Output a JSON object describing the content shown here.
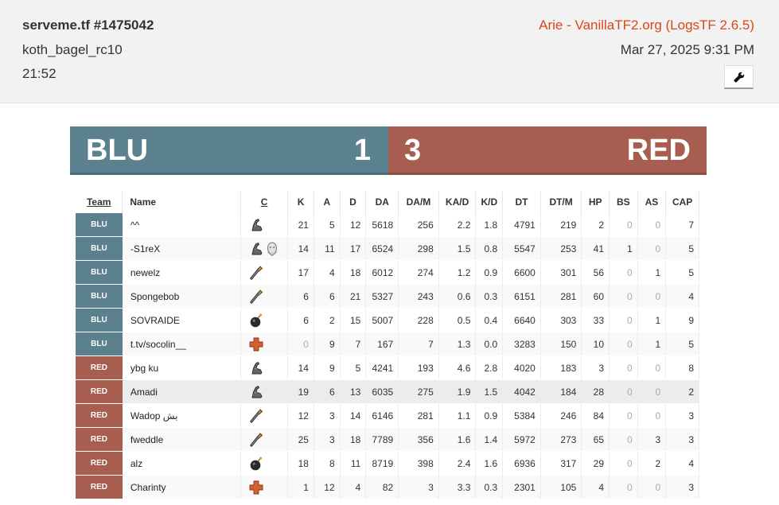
{
  "header": {
    "title": "serveme.tf #1475042",
    "map": "koth_bagel_rc10",
    "duration": "21:52",
    "uploader_link": "Arie - VanillaTF2.org (LogsTF 2.6.5)",
    "date": "Mar 27, 2025 9:31 PM",
    "tools_icon": "wrench-icon"
  },
  "score": {
    "blu_name": "BLU",
    "blu_score": "1",
    "red_score": "3",
    "red_name": "RED",
    "blu_color": "#5b818f",
    "red_color": "#a75d50"
  },
  "table": {
    "columns": [
      "Team",
      "Name",
      "C",
      "K",
      "A",
      "D",
      "DA",
      "DA/M",
      "KA/D",
      "K/D",
      "DT",
      "DT/M",
      "HP",
      "BS",
      "AS",
      "CAP"
    ],
    "rows": [
      {
        "team": "BLU",
        "name": "^^",
        "classes": [
          "scout"
        ],
        "k": "21",
        "a": "5",
        "d": "12",
        "da": "5618",
        "dam": "256",
        "kad": "2.2",
        "kd": "1.8",
        "dt": "4791",
        "dtm": "219",
        "hp": "2",
        "bs": "0",
        "as": "0",
        "cap": "7"
      },
      {
        "team": "BLU",
        "name": "-S1reX",
        "classes": [
          "scout",
          "spy"
        ],
        "k": "14",
        "a": "11",
        "d": "17",
        "da": "6524",
        "dam": "298",
        "kad": "1.5",
        "kd": "0.8",
        "dt": "5547",
        "dtm": "253",
        "hp": "41",
        "bs": "1",
        "as": "0",
        "cap": "5"
      },
      {
        "team": "BLU",
        "name": "newelz",
        "classes": [
          "soldier"
        ],
        "k": "17",
        "a": "4",
        "d": "18",
        "da": "6012",
        "dam": "274",
        "kad": "1.2",
        "kd": "0.9",
        "dt": "6600",
        "dtm": "301",
        "hp": "56",
        "bs": "0",
        "as": "1",
        "cap": "5"
      },
      {
        "team": "BLU",
        "name": "Spongebob",
        "classes": [
          "soldier"
        ],
        "k": "6",
        "a": "6",
        "d": "21",
        "da": "5327",
        "dam": "243",
        "kad": "0.6",
        "kd": "0.3",
        "dt": "6151",
        "dtm": "281",
        "hp": "60",
        "bs": "0",
        "as": "0",
        "cap": "4"
      },
      {
        "team": "BLU",
        "name": "SOVRAIDE",
        "classes": [
          "demoman"
        ],
        "k": "6",
        "a": "2",
        "d": "15",
        "da": "5007",
        "dam": "228",
        "kad": "0.5",
        "kd": "0.4",
        "dt": "6640",
        "dtm": "303",
        "hp": "33",
        "bs": "0",
        "as": "1",
        "cap": "9"
      },
      {
        "team": "BLU",
        "name": "t.tv/socolin__",
        "classes": [
          "medic"
        ],
        "k": "0",
        "a": "9",
        "d": "7",
        "da": "167",
        "dam": "7",
        "kad": "1.3",
        "kd": "0.0",
        "dt": "3283",
        "dtm": "150",
        "hp": "10",
        "bs": "0",
        "as": "1",
        "cap": "5"
      },
      {
        "team": "RED",
        "name": "ybg ku",
        "classes": [
          "scout"
        ],
        "k": "14",
        "a": "9",
        "d": "5",
        "da": "4241",
        "dam": "193",
        "kad": "4.6",
        "kd": "2.8",
        "dt": "4020",
        "dtm": "183",
        "hp": "3",
        "bs": "0",
        "as": "0",
        "cap": "8"
      },
      {
        "team": "RED",
        "name": "Amadi",
        "classes": [
          "scout"
        ],
        "k": "19",
        "a": "6",
        "d": "13",
        "da": "6035",
        "dam": "275",
        "kad": "1.9",
        "kd": "1.5",
        "dt": "4042",
        "dtm": "184",
        "hp": "28",
        "bs": "0",
        "as": "0",
        "cap": "2"
      },
      {
        "team": "RED",
        "name": "Wadop بش",
        "classes": [
          "soldier"
        ],
        "k": "12",
        "a": "3",
        "d": "14",
        "da": "6146",
        "dam": "281",
        "kad": "1.1",
        "kd": "0.9",
        "dt": "5384",
        "dtm": "246",
        "hp": "84",
        "bs": "0",
        "as": "0",
        "cap": "3"
      },
      {
        "team": "RED",
        "name": "fweddle",
        "classes": [
          "soldier"
        ],
        "k": "25",
        "a": "3",
        "d": "18",
        "da": "7789",
        "dam": "356",
        "kad": "1.6",
        "kd": "1.4",
        "dt": "5972",
        "dtm": "273",
        "hp": "65",
        "bs": "0",
        "as": "3",
        "cap": "3"
      },
      {
        "team": "RED",
        "name": "alz",
        "classes": [
          "demoman"
        ],
        "k": "18",
        "a": "8",
        "d": "11",
        "da": "8719",
        "dam": "398",
        "kad": "2.4",
        "kd": "1.6",
        "dt": "6936",
        "dtm": "317",
        "hp": "29",
        "bs": "0",
        "as": "2",
        "cap": "4"
      },
      {
        "team": "RED",
        "name": "Charinty",
        "classes": [
          "medic"
        ],
        "k": "1",
        "a": "12",
        "d": "4",
        "da": "82",
        "dam": "3",
        "kad": "3.3",
        "kd": "0.3",
        "dt": "2301",
        "dtm": "105",
        "hp": "4",
        "bs": "0",
        "as": "0",
        "cap": "3"
      }
    ]
  }
}
